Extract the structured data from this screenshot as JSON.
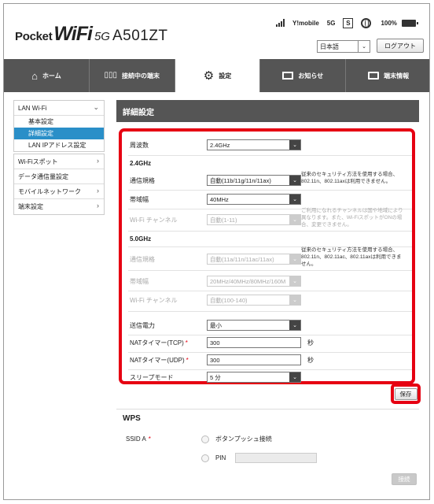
{
  "header": {
    "logo_pocket": "Pocket",
    "logo_wifi": "WiFi",
    "logo_5g": "5G",
    "logo_model": "A501ZT",
    "carrier": "Y!mobile",
    "network": "5G",
    "sim_letter": "S",
    "battery": "100%",
    "language": "日本語",
    "logout_label": "ログアウト"
  },
  "nav": {
    "tabs": [
      {
        "label": "ホーム",
        "icon": "home-icon"
      },
      {
        "label": "接続中の端末",
        "icon": "devices-icon"
      },
      {
        "label": "設定",
        "icon": "gear-icon",
        "active": true
      },
      {
        "label": "お知らせ",
        "icon": "mail-icon"
      },
      {
        "label": "端末情報",
        "icon": "monitor-icon"
      }
    ]
  },
  "sidebar": {
    "lan_wifi": "LAN Wi-Fi",
    "basic": "基本設定",
    "detail": "詳細設定",
    "lan_ip": "LAN IPアドレス設定",
    "wifi_spot": "Wi-Fiスポット",
    "data_usage": "データ通信量設定",
    "mobile_network": "モバイルネットワーク",
    "device_settings": "端末設定"
  },
  "main": {
    "title": "詳細設定",
    "frequency_label": "周波数",
    "frequency_value": "2.4GHz",
    "section_24": "2.4GHz",
    "std24_label": "通信規格",
    "std24_value": "自動(11b/11g/11n/11ax)",
    "std24_note": "従来のセキュリティ方法を使用する場合、802.11n、802.11axは利用できません。",
    "bw24_label": "帯域幅",
    "bw24_value": "40MHz",
    "ch24_label": "Wi-Fi チャンネル",
    "ch24_value": "自動(1-11)",
    "ch24_note": "ご利用になれるチャンネルは国や地域により異なります。また、Wi-FiスポットがONの場合、変更できません。",
    "section_5": "5.0GHz",
    "std5_label": "通信規格",
    "std5_value": "自動(11a/11n/11ac/11ax)",
    "std5_note": "従来のセキュリティ方法を使用する場合、802.11n、802.11ac、802.11axは利用できません。",
    "bw5_label": "帯域幅",
    "bw5_value": "20MHz/40MHz/80MHz/160M",
    "ch5_label": "Wi-Fi チャンネル",
    "ch5_value": "自動(100-140)",
    "tx_label": "送信電力",
    "tx_value": "最小",
    "nat_tcp_label": "NATタイマー(TCP)",
    "nat_tcp_value": "300",
    "nat_udp_label": "NATタイマー(UDP)",
    "nat_udp_value": "300",
    "unit_sec": "秒",
    "sleep_label": "スリープモード",
    "sleep_value": "5 分",
    "required_mark": "*",
    "save_label": "保存"
  },
  "wps": {
    "title": "WPS",
    "ssid_label": "SSID A",
    "push_label": "ボタンプッシュ接続",
    "pin_label": "PIN",
    "connect_label": "接続"
  }
}
